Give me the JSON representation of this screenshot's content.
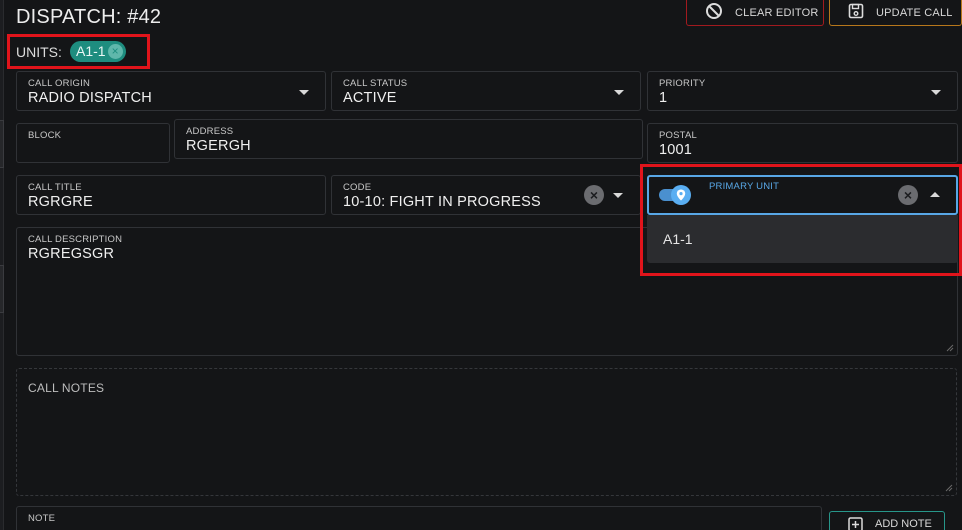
{
  "page": {
    "title": "DISPATCH: #42"
  },
  "units": {
    "label": "UNITS:",
    "chips": [
      "A1-1"
    ]
  },
  "toolbar": {
    "clear_label": "CLEAR EDITOR",
    "update_label": "UPDATE CALL"
  },
  "fields": {
    "call_origin": {
      "label": "CALL ORIGIN",
      "value": "RADIO DISPATCH"
    },
    "call_status": {
      "label": "CALL STATUS",
      "value": "ACTIVE"
    },
    "priority": {
      "label": "PRIORITY",
      "value": "1"
    },
    "block": {
      "label": "BLOCK",
      "value": ""
    },
    "address": {
      "label": "ADDRESS",
      "value": "RGERGH"
    },
    "postal": {
      "label": "POSTAL",
      "value": "1001"
    },
    "call_title": {
      "label": "CALL TITLE",
      "value": "RGRGRE"
    },
    "code": {
      "label": "CODE",
      "value": "10-10: FIGHT IN PROGRESS"
    },
    "primary_unit": {
      "label": "PRIMARY UNIT",
      "value": "",
      "options": [
        "A1-1"
      ]
    },
    "call_description": {
      "label": "CALL DESCRIPTION",
      "value": "RGREGSGR"
    },
    "call_notes": {
      "placeholder": "CALL NOTES"
    },
    "note": {
      "label": "NOTE",
      "value": ""
    }
  },
  "add_note_label": "ADD NOTE",
  "colors": {
    "background": "#141517",
    "chip": "#1e8d7f",
    "focus": "#58a7e6",
    "highlight": "#e0141b",
    "clear_border": "#a21a1f",
    "update_border": "#b7771b",
    "add_note_border": "#27968a"
  },
  "icons": {
    "clear_editor": "ban-icon",
    "update_call": "floppy-disk-icon",
    "primary_unit_toggle": "map-pin-icon",
    "add_note": "plus-square-icon"
  }
}
